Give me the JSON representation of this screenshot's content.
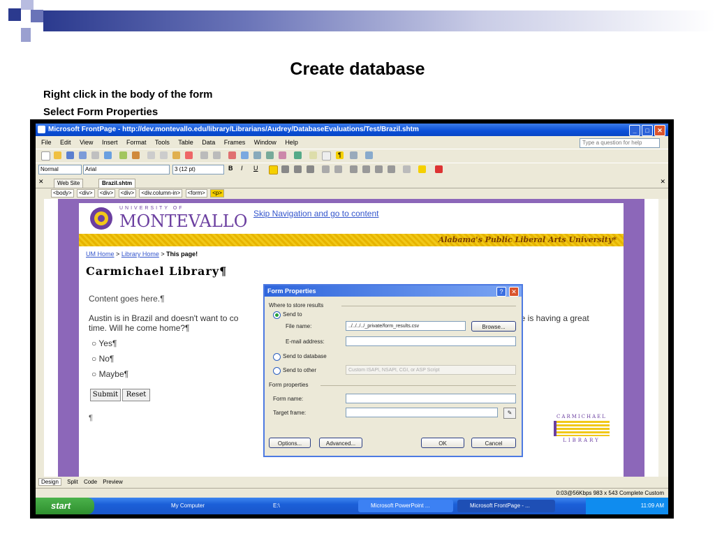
{
  "slide": {
    "title": "Create database",
    "bullets": [
      "Right click in the body of the form",
      "Select Form Properties"
    ]
  },
  "window": {
    "title": "Microsoft FrontPage - http://dev.montevallo.edu/library/Librarians/Audrey/DatabaseEvaluations/Test/Brazil.shtm",
    "menu": [
      "File",
      "Edit",
      "View",
      "Insert",
      "Format",
      "Tools",
      "Table",
      "Data",
      "Frames",
      "Window",
      "Help"
    ],
    "help_placeholder": "Type a question for help",
    "style_combo": "Normal",
    "font_combo": "Arial",
    "size_combo": "3 (12 pt)",
    "tabs": [
      "Web Site",
      "Brazil.shtm"
    ],
    "tags": [
      "<body>",
      "<div>",
      "<div>",
      "<div>",
      "<div.column-in>",
      "<form>",
      "<p>"
    ]
  },
  "page": {
    "logo_top": "UNIVERSITY OF",
    "logo_main": "MONTEVALLO",
    "skip_link": "Skip Navigation and go to content",
    "tagline": "Alabama's Public Liberal Arts University*",
    "crumb_home": "UM Home",
    "crumb_library": "Library Home",
    "crumb_current": "This page!",
    "crumb_sep": ">",
    "library_title": "Carmichael Library¶",
    "content_text": "Content goes here.¶",
    "paragraph_left": "Austin is in Brazil and doesn't want to co",
    "paragraph_left2": "time.  Will he come home?¶",
    "paragraph_right": "he is having a great",
    "options": [
      "Yes¶",
      "No¶",
      "Maybe¶"
    ],
    "submit": "Submit",
    "reset": "Reset",
    "pilcrow": "¶",
    "carm_top": "CARMICHAEL",
    "carm_bottom": "LIBRARY"
  },
  "dialog": {
    "title": "Form Properties",
    "group1": "Where to store results",
    "send_to": "Send to",
    "file_name_label": "File name:",
    "file_name_value": "../../../../_private/form_results.csv",
    "browse": "Browse...",
    "email_label": "E-mail address:",
    "send_to_database": "Send to database",
    "send_to_other": "Send to other",
    "other_value": "Custom ISAPI, NSAPI, CGI, or ASP Script",
    "group2": "Form properties",
    "form_name_label": "Form name:",
    "target_frame_label": "Target frame:",
    "options_btn": "Options...",
    "advanced_btn": "Advanced...",
    "ok_btn": "OK",
    "cancel_btn": "Cancel"
  },
  "bottom": {
    "views": [
      "Design",
      "Split",
      "Code",
      "Preview"
    ],
    "status": "0:03@56Kbps   983 x 543   Complete   Custom",
    "start": "start",
    "tasks": [
      "My Computer",
      "E:\\",
      "Microsoft PowerPoint ...",
      "Microsoft FrontPage - ..."
    ],
    "clock": "11:09 AM"
  },
  "colors": {
    "accent_blue": "#0a4fd8",
    "page_purple": "#8c67b9",
    "gold": "#e6b400"
  }
}
